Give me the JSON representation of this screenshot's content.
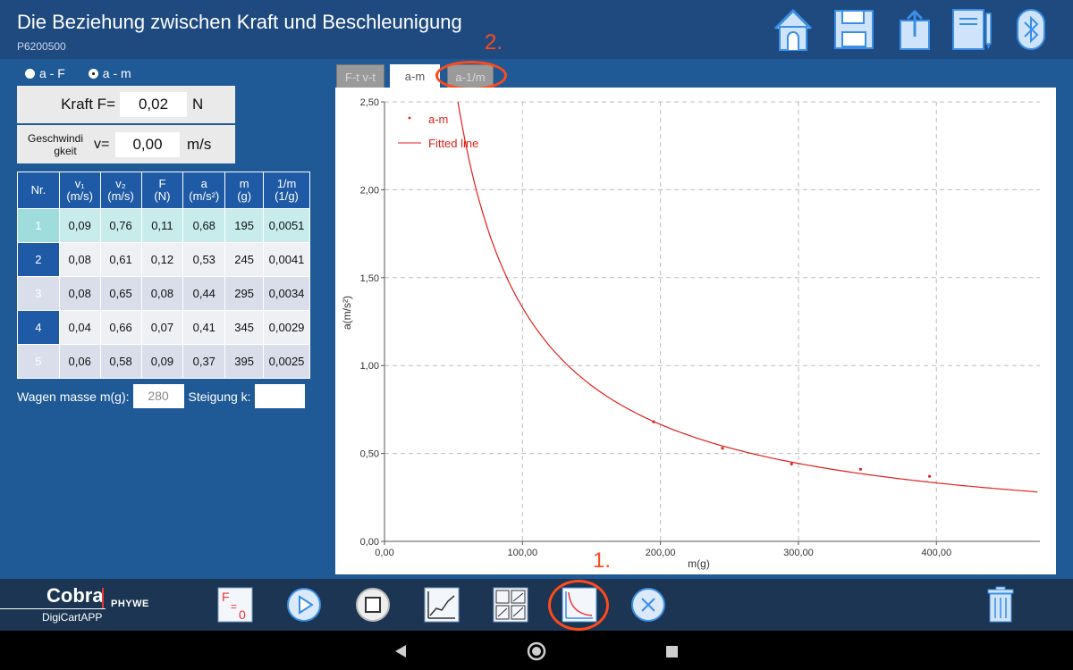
{
  "header": {
    "title": "Die Beziehung zwischen Kraft und Beschleunigung",
    "subtitle": "P6200500",
    "buttons": [
      "home-icon",
      "save-icon",
      "export-icon",
      "notebook-icon",
      "bluetooth-icon"
    ]
  },
  "mode": {
    "option_af": "a - F",
    "option_am": "a - m",
    "selected": "a - m"
  },
  "inputs": {
    "force_label": "Kraft F=",
    "force_value": "0,02",
    "force_unit": "N",
    "velocity_label_1": "Geschwindi",
    "velocity_label_2": "gkeit",
    "velocity_eq": "v=",
    "velocity_value": "0,00",
    "velocity_unit": "m/s"
  },
  "table": {
    "headers": [
      {
        "l1": "Nr.",
        "l2": ""
      },
      {
        "l1": "v₁",
        "l2": "(m/s)"
      },
      {
        "l1": "v₂",
        "l2": "(m/s)"
      },
      {
        "l1": "F",
        "l2": "(N)"
      },
      {
        "l1": "a",
        "l2": "(m/s²)"
      },
      {
        "l1": "m",
        "l2": "(g)"
      },
      {
        "l1": "1/m",
        "l2": "(1/g)"
      }
    ],
    "rows": [
      [
        "1",
        "0,09",
        "0,76",
        "0,11",
        "0,68",
        "195",
        "0,0051"
      ],
      [
        "2",
        "0,08",
        "0,61",
        "0,12",
        "0,53",
        "245",
        "0,0041"
      ],
      [
        "3",
        "0,08",
        "0,65",
        "0,08",
        "0,44",
        "295",
        "0,0034"
      ],
      [
        "4",
        "0,04",
        "0,66",
        "0,07",
        "0,41",
        "345",
        "0,0029"
      ],
      [
        "5",
        "0,06",
        "0,58",
        "0,09",
        "0,37",
        "395",
        "0,0025"
      ]
    ]
  },
  "mass": {
    "label": "Wagen masse m(g):",
    "value": "280",
    "slope_label": "Steigung k:",
    "slope_value": ""
  },
  "tabs": [
    {
      "label": "F-t v-t",
      "active": false
    },
    {
      "label": "a-m",
      "active": true
    },
    {
      "label": "a-1/m",
      "active": false
    }
  ],
  "annotations": {
    "one": "1.",
    "two": "2."
  },
  "toolbar": {
    "logo_main": "Cobra",
    "logo_sub": "DigiCartAPP",
    "logo_brand": "PHYWE",
    "buttons": [
      "zero-force-icon",
      "play-icon",
      "stop-icon",
      "line-chart-icon",
      "multi-chart-icon",
      "curve-chart-icon",
      "close-icon",
      "trash-icon"
    ]
  },
  "nav": [
    "back-icon",
    "home-circle-icon",
    "recents-icon"
  ],
  "chart_data": {
    "type": "scatter",
    "xlabel": "m(g)",
    "ylabel": "a(m/s²)",
    "xlim": [
      0,
      475
    ],
    "ylim": [
      0,
      2.5
    ],
    "xticks": [
      "0,00",
      "100,00",
      "200,00",
      "300,00",
      "400,00"
    ],
    "yticks": [
      "0,00",
      "0,50",
      "1,00",
      "1,50",
      "2,00",
      "2,50"
    ],
    "grid": true,
    "legend_placement": "top-left",
    "series": [
      {
        "name": "a-m",
        "color": "#e0201b",
        "x": [
          195,
          245,
          295,
          345,
          395
        ],
        "y": [
          0.68,
          0.53,
          0.44,
          0.41,
          0.37
        ]
      },
      {
        "name": "Fitted line",
        "color": "#e0201b",
        "fit": "a = k/m",
        "k": 133
      }
    ]
  }
}
